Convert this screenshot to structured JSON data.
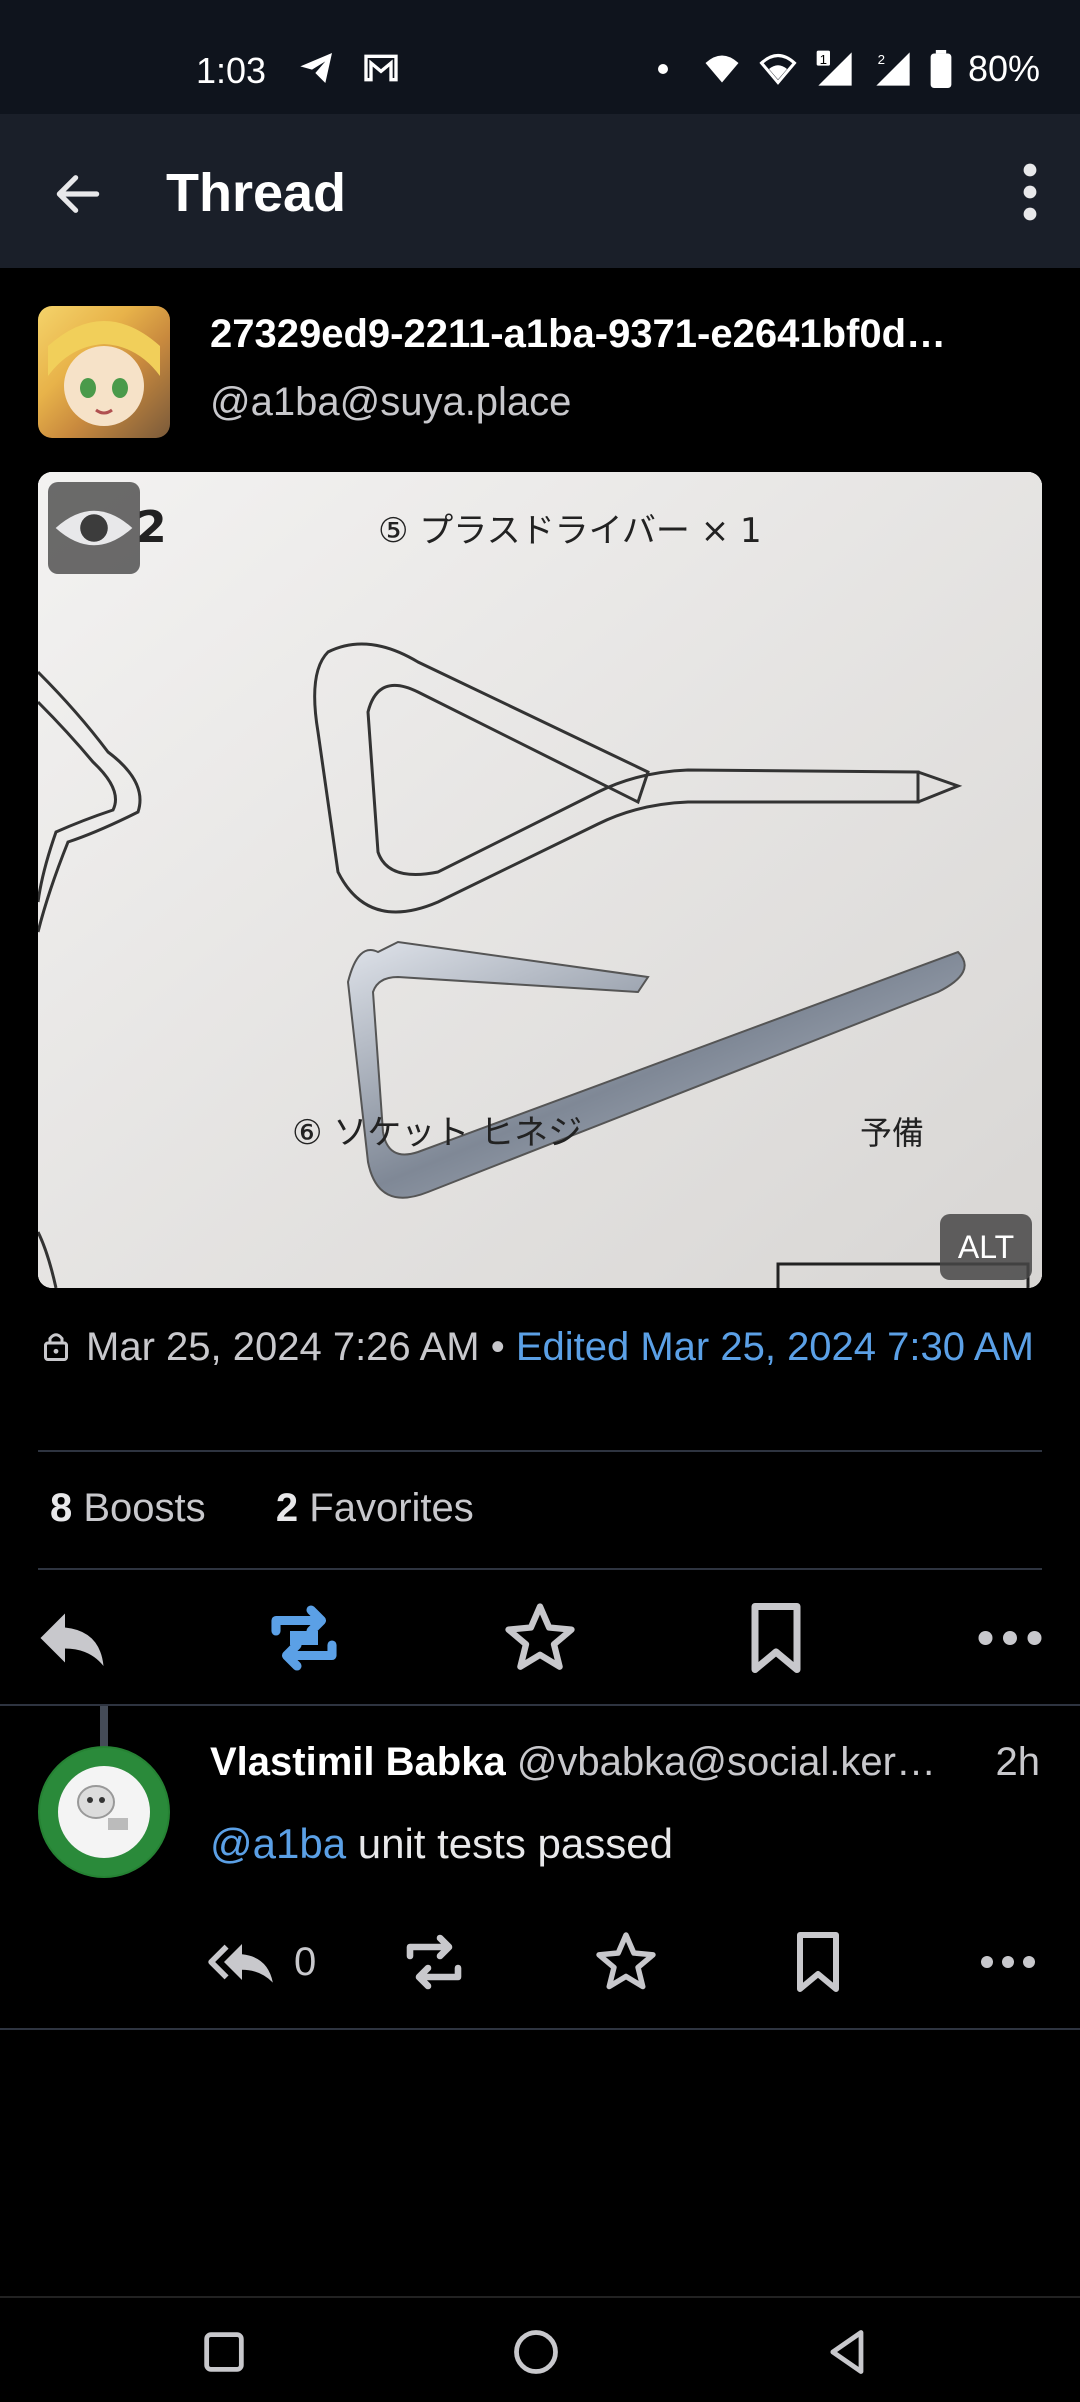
{
  "status_bar": {
    "time": "1:03",
    "left_icons": [
      "telegram-icon",
      "gmail-icon"
    ],
    "right_icons": [
      "dot-icon",
      "wifi-icon",
      "wifi-icon-2",
      "signal-1-icon",
      "signal-2-icon",
      "battery-icon"
    ],
    "battery": "80%"
  },
  "app_bar": {
    "title": "Thread",
    "back_icon": "arrow-left-icon",
    "menu_icon": "more-vertical-icon"
  },
  "post": {
    "display_name": "27329ed9-2211-a1ba-9371-e2641bf0d…",
    "handle": "@a1ba@suya.place",
    "media_alt_label": "ALT",
    "media_caption_text": [
      "⑤ プラスドライバー × 1",
      "⑥ ソケット ヒネジ",
      "予備",
      "2"
    ],
    "visibility_icon": "lock-icon",
    "timestamp": "Mar 25, 2024 7:26 AM",
    "edited_text": "Edited Mar 25, 2024 7:30 AM",
    "boosts_count": "8",
    "boosts_label": "Boosts",
    "favorites_count": "2",
    "favorites_label": "Favorites"
  },
  "reply": {
    "display_name": "Vlastimil Babka",
    "handle": "@vbabka@social.ker…",
    "time": "2h",
    "mention": "@a1ba",
    "text": " unit tests passed",
    "reply_count": "0"
  },
  "colors": {
    "accent": "#5ba0e6",
    "background": "#000000",
    "appbar": "#1a1f29",
    "statusbar": "#0f141d"
  }
}
